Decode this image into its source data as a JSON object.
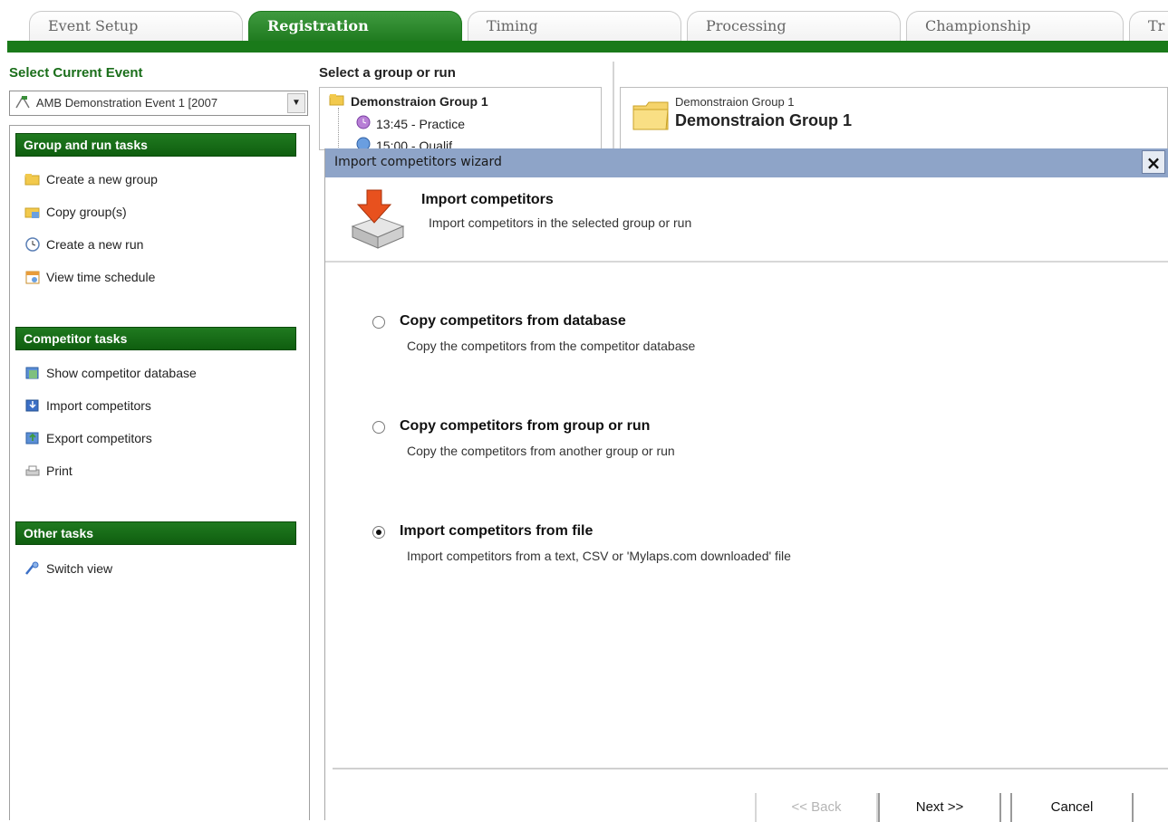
{
  "tabs": [
    {
      "label": "Event Setup",
      "active": false
    },
    {
      "label": "Registration",
      "active": true
    },
    {
      "label": "Timing",
      "active": false
    },
    {
      "label": "Processing",
      "active": false
    },
    {
      "label": "Championship",
      "active": false
    },
    {
      "label": "Tr",
      "active": false
    }
  ],
  "left": {
    "select_event_title": "Select Current Event",
    "event_value": "AMB Demonstration Event 1 [2007",
    "group_tasks_header": "Group and run tasks",
    "group_tasks": [
      "Create a new group",
      "Copy group(s)",
      "Create a new run",
      "View time schedule"
    ],
    "competitor_tasks_header": "Competitor tasks",
    "competitor_tasks": [
      "Show competitor database",
      "Import competitors",
      "Export competitors",
      "Print"
    ],
    "other_tasks_header": "Other tasks",
    "other_tasks": [
      "Switch view"
    ]
  },
  "tree": {
    "title": "Select a group or run",
    "group": "Demonstraion Group 1",
    "run": "13:45 - Practice",
    "run2": "15:00 - Qualif"
  },
  "group_header": {
    "small": "Demonstraion Group 1",
    "large": "Demonstraion Group 1"
  },
  "wizard": {
    "title": "Import competitors wizard",
    "close": "×",
    "heading": "Import competitors",
    "subheading": "Import competitors in the selected group or run",
    "options": [
      {
        "title": "Copy competitors from database",
        "desc": "Copy the competitors from the competitor database",
        "checked": false
      },
      {
        "title": "Copy competitors from group or run",
        "desc": "Copy the competitors from another group or run",
        "checked": false
      },
      {
        "title": "Import competitors from file",
        "desc": "Import competitors from a text, CSV or 'Mylaps.com downloaded' file",
        "checked": true
      }
    ],
    "back_label": "<< Back",
    "next_label": "Next >>",
    "cancel_label": "Cancel"
  },
  "colors": {
    "brand_green": "#1a7a1a",
    "wizard_title": "#8ea4c8"
  }
}
